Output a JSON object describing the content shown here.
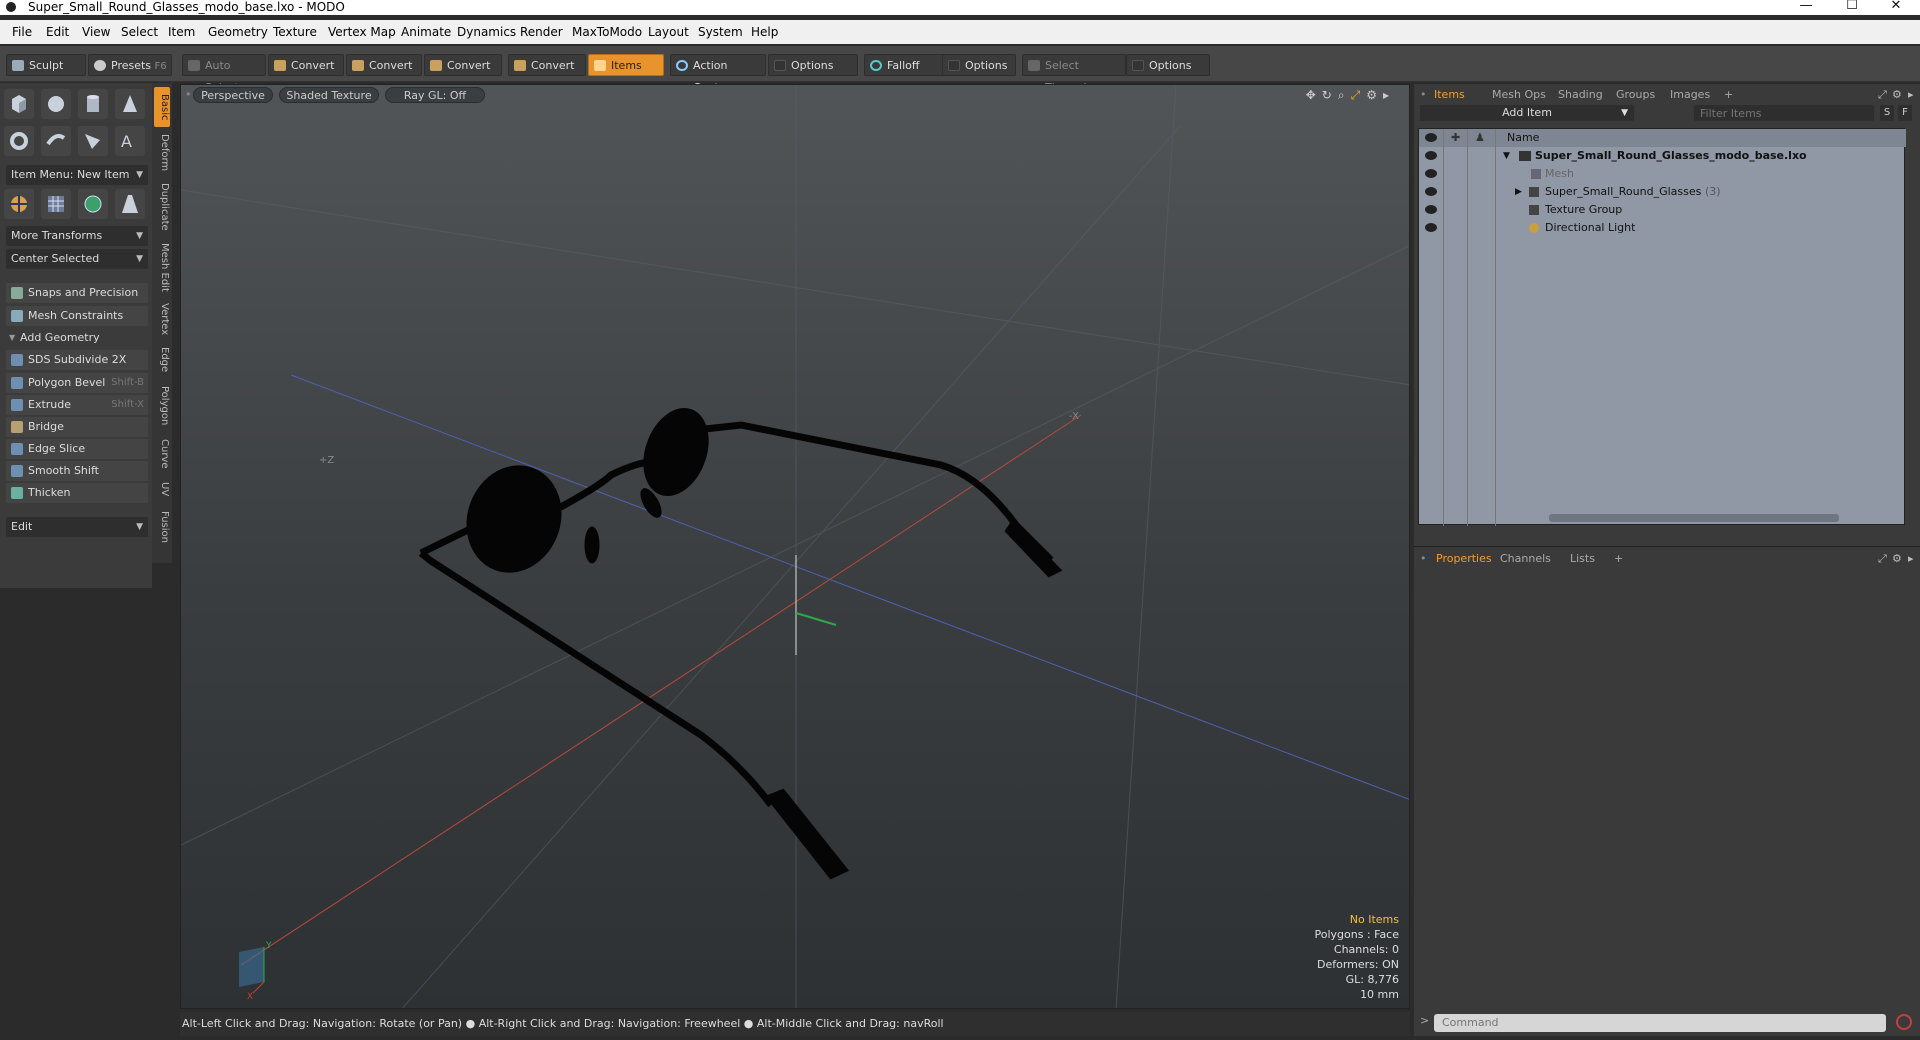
{
  "window": {
    "title": "Super_Small_Round_Glasses_modo_base.lxo - MODO",
    "controls": [
      "—",
      "☐",
      "✕"
    ]
  },
  "menu": [
    "File",
    "Edit",
    "View",
    "Select",
    "Item",
    "Geometry",
    "Texture",
    "Vertex Map",
    "Animate",
    "Dynamics",
    "Render",
    "MaxToModo",
    "Layout",
    "System",
    "Help"
  ],
  "toolbar": {
    "sculpt": "Sculpt",
    "presets": "Presets",
    "presets_key": "F6",
    "auto_select": "Auto Select",
    "convert1": "Convert",
    "convert2": "Convert",
    "convert3": "Convert",
    "convert4": "Convert",
    "items": "Items",
    "action_center": "Action Center",
    "options1": "Options",
    "falloff": "Falloff",
    "options2": "Options",
    "select_through": "Select Through",
    "options3": "Options"
  },
  "left": {
    "item_menu": "Item Menu: New Item",
    "more_transforms": "More Transforms",
    "center_selected": "Center Selected",
    "snaps": "Snaps and Precision",
    "mesh_constraints": "Mesh Constraints",
    "add_geometry": "Add Geometry",
    "tools": [
      {
        "label": "SDS Subdivide 2X",
        "shortcut": ""
      },
      {
        "label": "Polygon Bevel",
        "shortcut": "Shift-B"
      },
      {
        "label": "Extrude",
        "shortcut": "Shift-X"
      },
      {
        "label": "Bridge",
        "shortcut": ""
      },
      {
        "label": "Edge Slice",
        "shortcut": ""
      },
      {
        "label": "Smooth Shift",
        "shortcut": ""
      },
      {
        "label": "Thicken",
        "shortcut": ""
      }
    ],
    "edit": "Edit",
    "vtabs": [
      "Basic",
      "Deform",
      "Duplicate",
      "Mesh Edit",
      "Vertex",
      "Edge",
      "Polygon",
      "Curve",
      "UV",
      "Fusion"
    ]
  },
  "viewport": {
    "perspective": "Perspective",
    "shading": "Shaded Texture",
    "raygl": "Ray GL: Off",
    "axis_x": "-X",
    "axis_z": "+Z",
    "info": {
      "items": "No Items",
      "polygons": "Polygons : Face",
      "channels": "Channels: 0",
      "deformers": "Deformers: ON",
      "gl": "GL: 8,776",
      "unit": "10 mm"
    }
  },
  "status": "Alt-Left Click and Drag: Navigation: Rotate (or Pan) ● Alt-Right Click and Drag: Navigation: Freewheel ● Alt-Middle Click and Drag: navRoll",
  "right": {
    "tabs": [
      "Items",
      "Mesh Ops",
      "Shading",
      "Groups",
      "Images",
      "+"
    ],
    "add_item": "Add Item",
    "filter_placeholder": "Filter Items",
    "s": "S",
    "f": "F",
    "name_header": "Name",
    "tree": [
      {
        "label": "Super_Small_Round_Glasses_modo_base.lxo",
        "count": ""
      },
      {
        "label": "Mesh",
        "count": ""
      },
      {
        "label": "Super_Small_Round_Glasses",
        "count": "(3)"
      },
      {
        "label": "Texture Group",
        "count": ""
      },
      {
        "label": "Directional Light",
        "count": ""
      }
    ],
    "bottom_tabs": [
      "Properties",
      "Channels",
      "Lists",
      "+"
    ],
    "command_placeholder": "Command"
  }
}
